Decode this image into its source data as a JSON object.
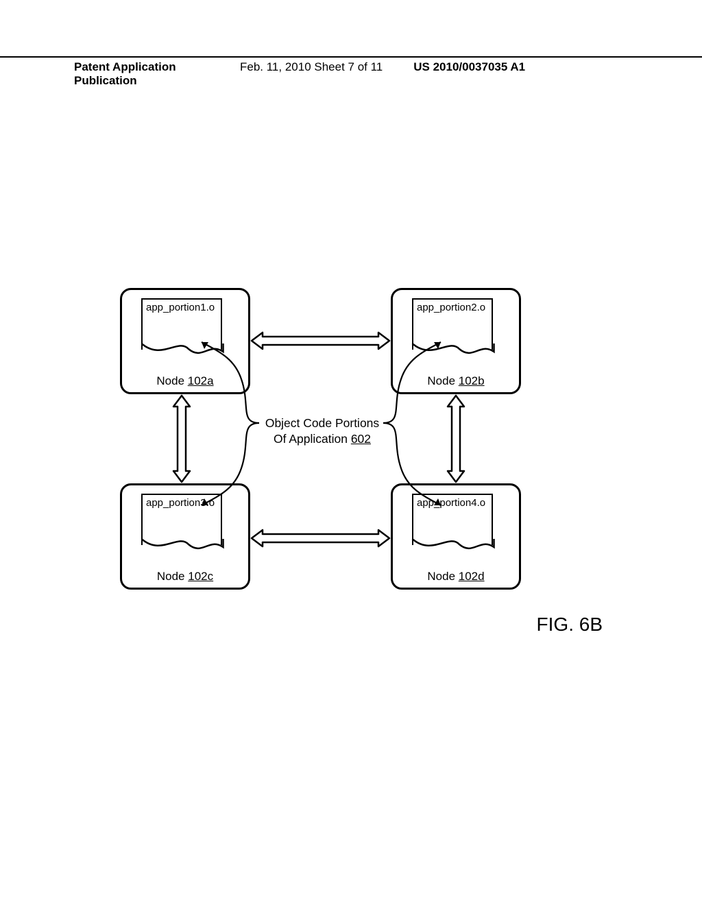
{
  "header": {
    "left": "Patent Application Publication",
    "center": "Feb. 11, 2010  Sheet 7 of 11",
    "right": "US 2010/0037035 A1"
  },
  "nodes": {
    "a": {
      "file": "app_portion1.o",
      "label_prefix": "Node ",
      "label_ref": "102a"
    },
    "b": {
      "file": "app_portion2.o",
      "label_prefix": "Node ",
      "label_ref": "102b"
    },
    "c": {
      "file": "app_portion3.o",
      "label_prefix": "Node ",
      "label_ref": "102c"
    },
    "d": {
      "file": "app_portion4.o",
      "label_prefix": "Node ",
      "label_ref": "102d"
    }
  },
  "center": {
    "line1": "Object Code Portions",
    "line2_prefix": "Of Application ",
    "line2_ref": "602"
  },
  "figure_caption": "FIG. 6B"
}
